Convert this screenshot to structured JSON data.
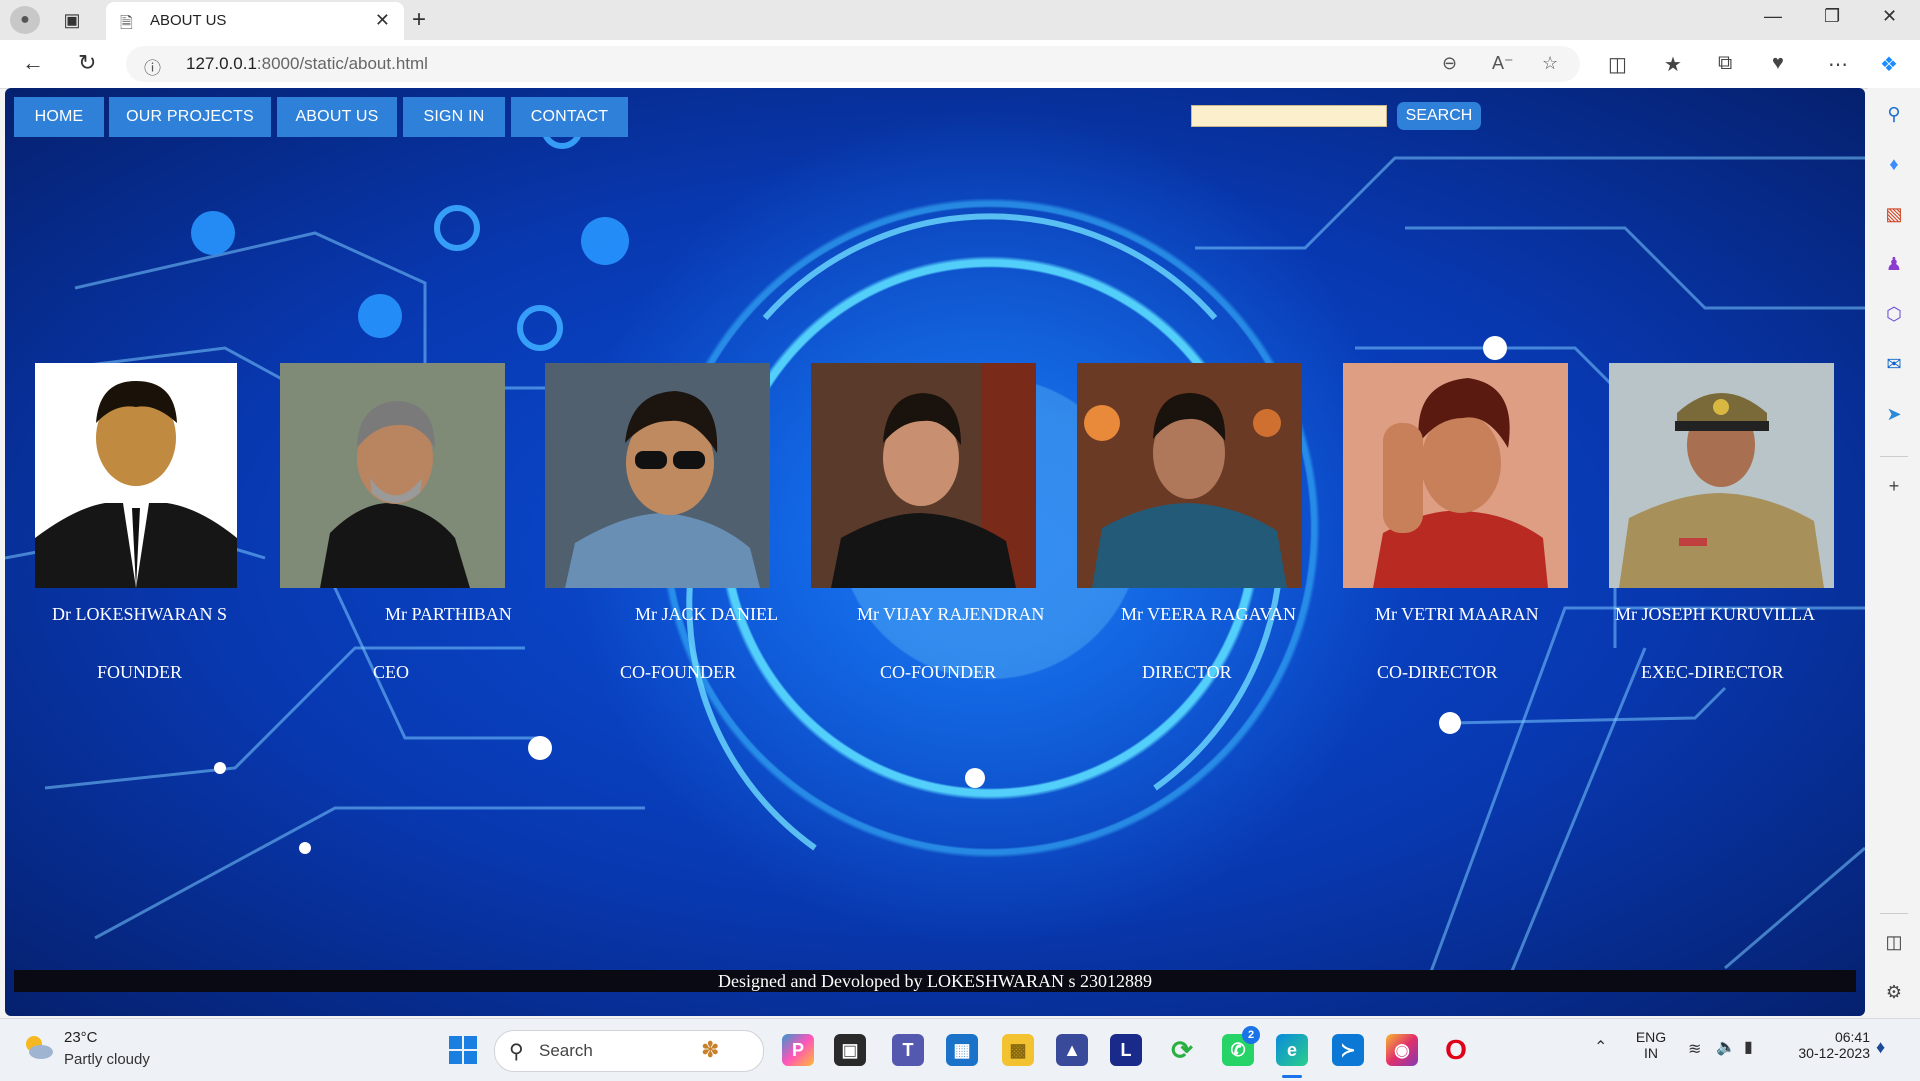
{
  "browser": {
    "tab_title": "ABOUT US",
    "url_host": "127.0.0.1",
    "url_rest": ":8000/static/about.html"
  },
  "site": {
    "nav": [
      "HOME",
      "OUR PROJECTS",
      "ABOUT US",
      "SIGN IN",
      "CONTACT"
    ],
    "search_button": "SEARCH",
    "search_value": "",
    "team": [
      {
        "name": "Dr LOKESHWARAN S",
        "role": "FOUNDER"
      },
      {
        "name": "Mr PARTHIBAN",
        "role": "CEO"
      },
      {
        "name": "Mr JACK DANIEL",
        "role": "CO-FOUNDER"
      },
      {
        "name": "Mr VIJAY RAJENDRAN",
        "role": "CO-FOUNDER"
      },
      {
        "name": "Mr VEERA RAGAVAN",
        "role": "DIRECTOR"
      },
      {
        "name": "Mr VETRI MAARAN",
        "role": "CO-DIRECTOR"
      },
      {
        "name": "Mr JOSEPH KURUVILLA",
        "role": "EXEC-DIRECTOR"
      }
    ],
    "footer": "Designed and Devoloped by LOKESHWARAN s 23012889"
  },
  "taskbar": {
    "weather_temp": "23°C",
    "weather_desc": "Partly cloudy",
    "search_label": "Search",
    "whatsapp_badge": "2",
    "lang_top": "ENG",
    "lang_bottom": "IN",
    "time": "06:41",
    "date": "30-12-2023"
  },
  "colors": {
    "nav_button": "#2f80d8",
    "page_bg": "#0838b0",
    "footer_bg": "#0a0a14",
    "search_input_bg": "#fcf0cc"
  }
}
